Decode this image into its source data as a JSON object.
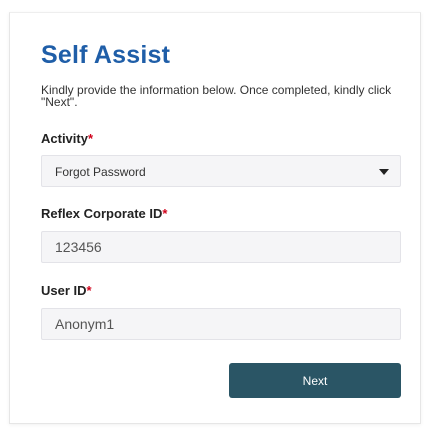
{
  "form": {
    "title": "Self Assist",
    "intro": "Kindly provide the information below. Once completed, kindly click \"Next\".",
    "required_marker": "*",
    "activity": {
      "label": "Activity",
      "selected": "Forgot Password"
    },
    "corporate_id": {
      "label": "Reflex Corporate ID",
      "value": "123456"
    },
    "user_id": {
      "label": "User ID",
      "value": "Anonym1"
    },
    "next_label": "Next"
  },
  "colors": {
    "title": "#1f5ea8",
    "required": "#d0021b",
    "button_bg": "#2a5565",
    "field_bg": "#f5f5f7"
  },
  "icons": {
    "activity_dropdown": "caret-down-icon"
  }
}
